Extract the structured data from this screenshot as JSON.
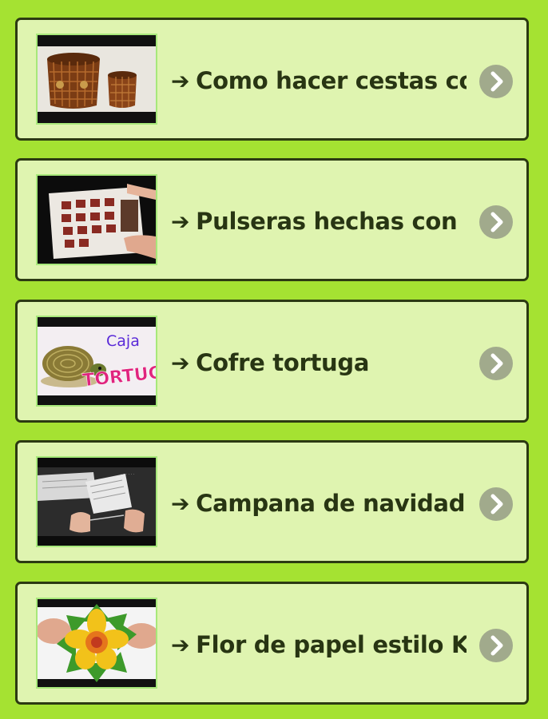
{
  "items": [
    {
      "title": "Como hacer cestas co...",
      "thumb_icon": "wicker-baskets-thumbnail"
    },
    {
      "title": "Pulseras hechas con r...",
      "thumb_icon": "bracelets-tutorial-thumbnail"
    },
    {
      "title": "Cofre tortuga",
      "thumb_icon": "turtle-box-thumbnail",
      "thumb_text": [
        "Caja",
        "TORTUGA"
      ]
    },
    {
      "title": "Campana de navidad",
      "thumb_icon": "christmas-bell-thumbnail"
    },
    {
      "title": "Flor de papel estilo Ku...",
      "thumb_icon": "paper-flower-thumbnail"
    }
  ],
  "arrow_glyph": "➔",
  "colors": {
    "background": "#a5e232",
    "card": "#dff4b0",
    "card_border": "#2c3a12",
    "title_text": "#283513",
    "chevron_circle": "#a1aa8c"
  }
}
